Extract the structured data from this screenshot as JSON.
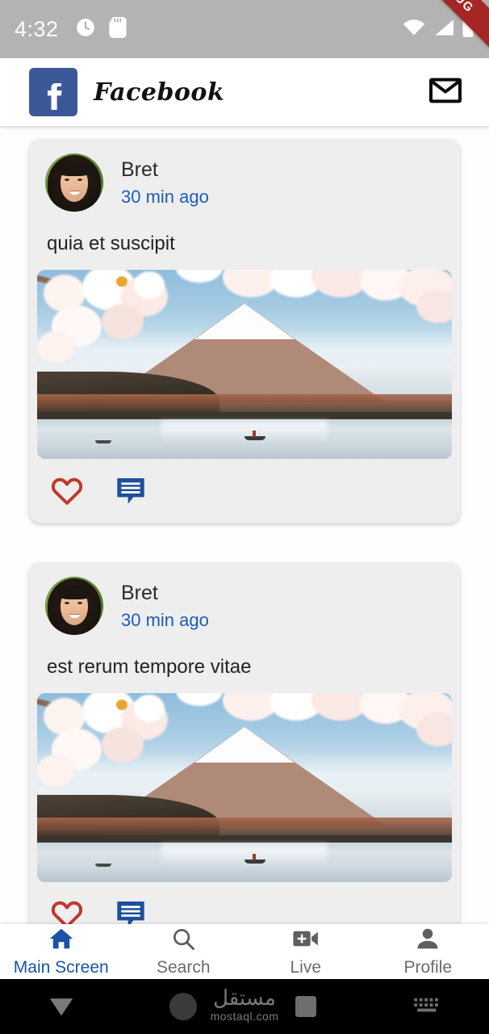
{
  "status_bar": {
    "time": "4:32",
    "icons": [
      "alarm-icon",
      "sd-card-icon",
      "wifi-icon",
      "cellular-signal-icon",
      "battery-icon"
    ],
    "background_color": "#b3b3b3"
  },
  "debug_banner": {
    "label": "DEBUG",
    "color": "#a62626"
  },
  "app_bar": {
    "logo_letter": "f",
    "logo_color": "#3b5998",
    "title": "Facebook",
    "action_icon": "mail-icon"
  },
  "feed": {
    "posts": [
      {
        "author": "Bret",
        "time": "30 min ago",
        "body": "quia et suscipit",
        "image_alt": "mount-fuji-lake-cherry-blossom",
        "like_icon": "heart-outline-icon",
        "comment_icon": "comment-bubble-icon"
      },
      {
        "author": "Bret",
        "time": "30 min ago",
        "body": "est rerum tempore vitae",
        "image_alt": "mount-fuji-lake-cherry-blossom",
        "like_icon": "heart-outline-icon",
        "comment_icon": "comment-bubble-icon"
      }
    ]
  },
  "bottom_nav": {
    "active_color": "#1a53a8",
    "inactive_color": "#6b6b6b",
    "items": [
      {
        "label": "Main Screen",
        "icon": "home-icon",
        "active": true
      },
      {
        "label": "Search",
        "icon": "search-icon",
        "active": false
      },
      {
        "label": "Live",
        "icon": "video-camera-plus-icon",
        "active": false
      },
      {
        "label": "Profile",
        "icon": "person-icon",
        "active": false
      }
    ]
  },
  "system_nav": {
    "buttons": [
      "back-icon",
      "home-icon",
      "recents-icon",
      "keyboard-icon"
    ]
  },
  "watermark": {
    "arabic": "مستقل",
    "latin": "mostaql.com"
  },
  "colors": {
    "page_background": "#fdfdfd",
    "card_background": "#eeeeee",
    "link_blue": "#1c5cb8",
    "heart_red": "#c0392b",
    "comment_blue": "#1d4f9c"
  }
}
